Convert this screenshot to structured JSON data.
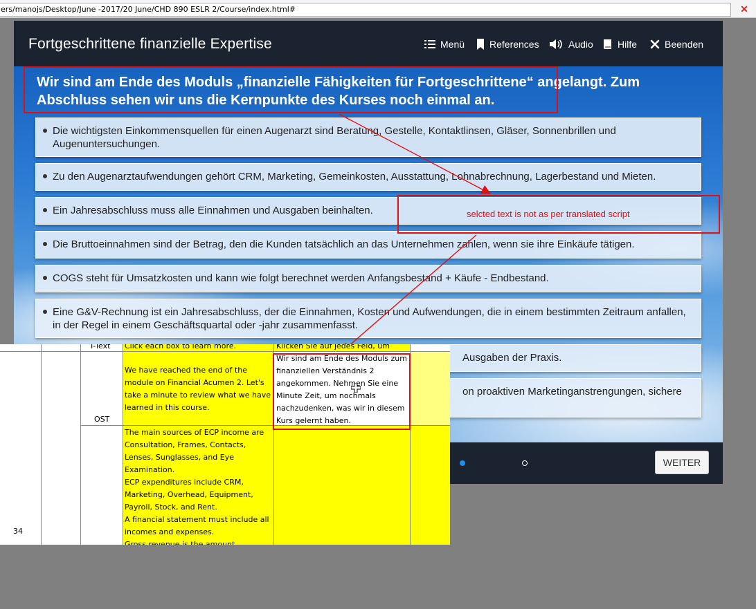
{
  "browser": {
    "address": "ers/manojs/Desktop/June -2017/20 June/CHD 890 ESLR 2/Course/index.html#"
  },
  "course": {
    "title": "Fortgeschrittene finanzielle Expertise",
    "nav": {
      "menu": "Menü",
      "references": "References",
      "audio": "Audio",
      "help": "Hilfe",
      "exit": "Beenden"
    },
    "intro": "Wir sind am Ende des Moduls „finanzielle Fähigkeiten für Fortgeschrittene“ angelangt. Zum Abschluss sehen wir uns die Kernpunkte des Kurses noch einmal an.",
    "bullets": [
      "Die wichtigsten Einkommensquellen für einen Augenarzt sind Beratung, Gestelle, Kontaktlinsen, Gläser, Sonnenbrillen und Augenuntersuchungen.",
      "Zu den Augenarztaufwendungen gehört CRM, Marketing, Gemeinkosten, Ausstattung, Lohnabrechnung, Lagerbestand und Mieten.",
      "Ein Jahresabschluss muss alle Einnahmen und Ausgaben beinhalten.",
      "Die Bruttoeinnahmen sind der Betrag, den die Kunden tatsächlich an das Unternehmen zahlen, wenn sie ihre Einkäufe tätigen.",
      "COGS steht für Umsatzkosten und kann wie folgt berechnet werden Anfangsbestand + Käufe - Endbestand.",
      "Eine G&V-Rechnung ist ein Jahresabschluss, der die Einnahmen, Kosten und Aufwendungen, die in einem bestimmten Zeitraum anfallen, in der Regel in einem Geschäftsquartal oder -jahr zusammenfasst.",
      "Ausgaben der Praxis.",
      "on proaktiven Marketinganstrengungen, sichere"
    ],
    "next_button": "WEITER"
  },
  "annotation": {
    "note": "selcted text is not as per translated script"
  },
  "spreadsheet": {
    "row_number": "34",
    "type_top": "I-Text",
    "type_ost": "OST",
    "cell_top_en": "Click each box to learn more.",
    "cell_top_de": "Klicken Sie auf jedes Feld, um",
    "cell_ost_en": "We have reached the end of the\nmodule on Financial Acumen 2. Let's\ntake a minute to review what we have\nlearned in this course.",
    "cell_ost_de": "Wir sind am Ende des Moduls zum\nfinanziellen Verständnis 2\nangekommen. Nehmen Sie eine\nMinute Zeit, um nochmals\nnachzudenken, was wir in diesem\nKurs gelernt haben.",
    "cell_main_en": "The main sources of ECP income are\nConsultation, Frames, Contacts,\nLenses, Sunglasses, and Eye\nExamination.\nECP expenditures include CRM,\nMarketing, Overhead, Equipment,\nPayroll, Stock, and Rent.\nA financial statement must include all\nincomes and expenses.\nGross revenue is the amount"
  },
  "colors": {
    "highlight": "#ffff00",
    "annotation": "#e01010",
    "bar": "#1b2230",
    "active_dot": "#1e90e8"
  }
}
